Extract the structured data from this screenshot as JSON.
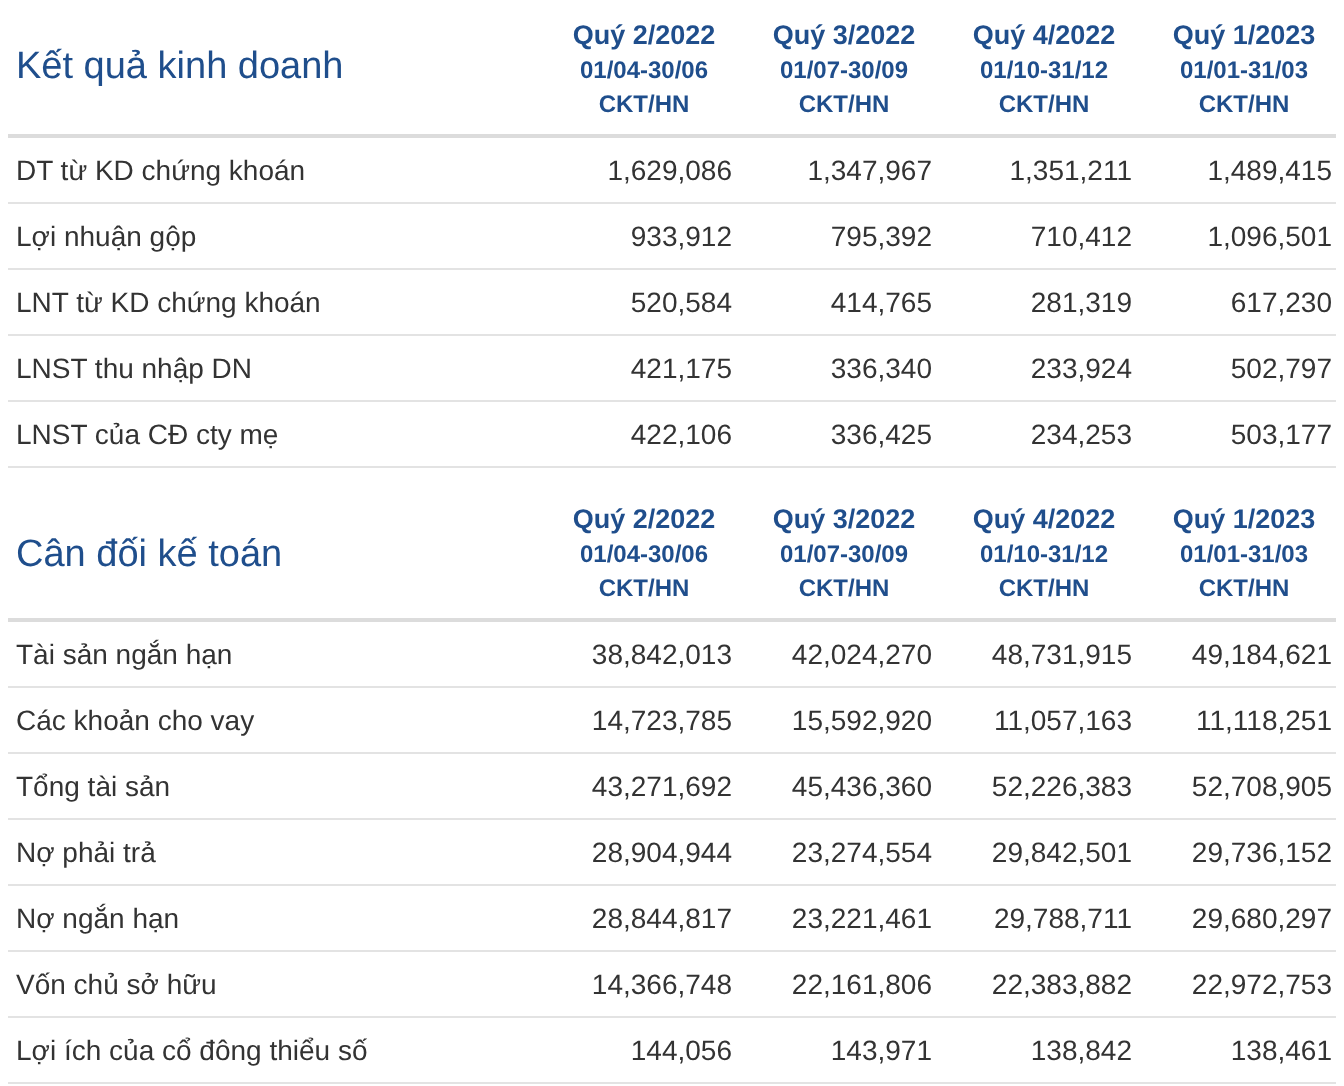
{
  "sections": [
    {
      "title": "Kết quả kinh doanh",
      "columns": [
        {
          "quarter": "Quý 2/2022",
          "range": "01/04-30/06",
          "basis": "CKT/HN"
        },
        {
          "quarter": "Quý 3/2022",
          "range": "01/07-30/09",
          "basis": "CKT/HN"
        },
        {
          "quarter": "Quý 4/2022",
          "range": "01/10-31/12",
          "basis": "CKT/HN"
        },
        {
          "quarter": "Quý 1/2023",
          "range": "01/01-31/03",
          "basis": "CKT/HN"
        }
      ],
      "rows": [
        {
          "label": "DT từ KD chứng khoán",
          "values": [
            "1,629,086",
            "1,347,967",
            "1,351,211",
            "1,489,415"
          ]
        },
        {
          "label": "Lợi nhuận gộp",
          "values": [
            "933,912",
            "795,392",
            "710,412",
            "1,096,501"
          ]
        },
        {
          "label": "LNT từ KD chứng khoán",
          "values": [
            "520,584",
            "414,765",
            "281,319",
            "617,230"
          ]
        },
        {
          "label": "LNST thu nhập DN",
          "values": [
            "421,175",
            "336,340",
            "233,924",
            "502,797"
          ]
        },
        {
          "label": "LNST của CĐ cty mẹ",
          "values": [
            "422,106",
            "336,425",
            "234,253",
            "503,177"
          ]
        }
      ]
    },
    {
      "title": "Cân đối kế toán",
      "columns": [
        {
          "quarter": "Quý 2/2022",
          "range": "01/04-30/06",
          "basis": "CKT/HN"
        },
        {
          "quarter": "Quý 3/2022",
          "range": "01/07-30/09",
          "basis": "CKT/HN"
        },
        {
          "quarter": "Quý 4/2022",
          "range": "01/10-31/12",
          "basis": "CKT/HN"
        },
        {
          "quarter": "Quý 1/2023",
          "range": "01/01-31/03",
          "basis": "CKT/HN"
        }
      ],
      "rows": [
        {
          "label": "Tài sản ngắn hạn",
          "values": [
            "38,842,013",
            "42,024,270",
            "48,731,915",
            "49,184,621"
          ]
        },
        {
          "label": "Các khoản cho vay",
          "values": [
            "14,723,785",
            "15,592,920",
            "11,057,163",
            "11,118,251"
          ]
        },
        {
          "label": "Tổng tài sản",
          "values": [
            "43,271,692",
            "45,436,360",
            "52,226,383",
            "52,708,905"
          ]
        },
        {
          "label": "Nợ phải trả",
          "values": [
            "28,904,944",
            "23,274,554",
            "29,842,501",
            "29,736,152"
          ]
        },
        {
          "label": "Nợ ngắn hạn",
          "values": [
            "28,844,817",
            "23,221,461",
            "29,788,711",
            "29,680,297"
          ]
        },
        {
          "label": "Vốn chủ sở hữu",
          "values": [
            "14,366,748",
            "22,161,806",
            "22,383,882",
            "22,972,753"
          ]
        },
        {
          "label": "Lợi ích của cổ đông thiểu số",
          "values": [
            "144,056",
            "143,971",
            "138,842",
            "138,461"
          ]
        }
      ]
    }
  ]
}
